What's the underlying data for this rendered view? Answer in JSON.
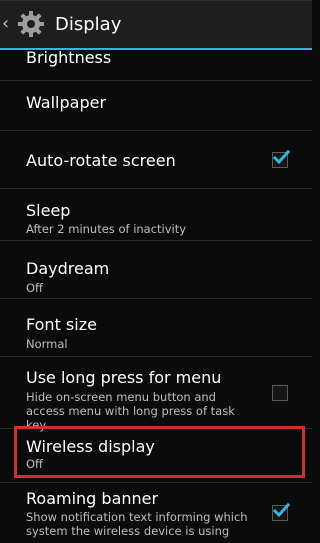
{
  "header": {
    "title": "Display"
  },
  "items": [
    {
      "label": "Brightness"
    },
    {
      "label": "Wallpaper"
    },
    {
      "label": "Auto-rotate screen",
      "checkbox": true,
      "checked": true
    },
    {
      "label": "Sleep",
      "summary": "After 2 minutes of inactivity"
    },
    {
      "label": "Daydream",
      "summary": "Off"
    },
    {
      "label": "Font size",
      "summary": "Normal"
    },
    {
      "label": "Use long press for menu",
      "summary": "Hide on-screen menu button and access menu with long press of task key",
      "checkbox": true,
      "checked": false
    },
    {
      "label": "Wireless display",
      "summary": "Off",
      "highlighted": true
    },
    {
      "label": "Roaming banner",
      "summary": "Show notification text informing which system the wireless device is using",
      "checkbox": true,
      "checked": true
    }
  ],
  "colors": {
    "accent": "#33b5e5",
    "highlight_border": "#d32f2f",
    "background": "#0b0b0b"
  }
}
